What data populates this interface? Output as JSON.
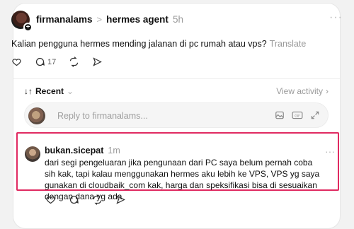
{
  "post": {
    "username": "firmanalams",
    "separator": ">",
    "community": "hermes agent",
    "time": "5h",
    "text": "Kalian pengguna hermes mending jalanan di pc rumah atau vps?",
    "translate": "Translate",
    "reply_count": "17",
    "more": "···"
  },
  "sort": {
    "label": "Recent",
    "view_activity": "View activity"
  },
  "reply_input": {
    "placeholder": "Reply to firmanalams..."
  },
  "comment": {
    "username": "bukan.sicepat",
    "time": "1m",
    "text": "dari segi pengeluaran jika pengunaan dari PC saya belum pernah coba sih kak, tapi kalau menggunakan hermes aku lebih ke VPS, VPS yg saya gunakan di cloudbaik_com kak, harga dan speksifikasi bisa di sesuaikan dengan dana yg ada",
    "more": "···"
  },
  "icons": {
    "like": "heart-icon",
    "reply": "comment-icon",
    "repost": "repost-icon",
    "share": "send-icon",
    "image": "image-icon",
    "gif": "gif-icon",
    "expand": "expand-icon"
  },
  "colors": {
    "highlight": "#e02a61"
  }
}
